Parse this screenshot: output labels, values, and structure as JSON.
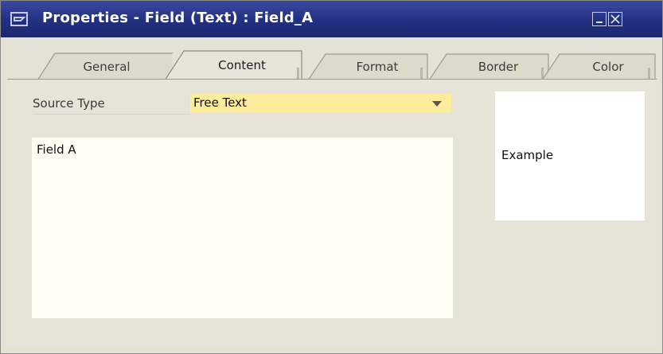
{
  "window": {
    "title": "Properties - Field (Text) : Field_A",
    "icon": "window-properties-icon"
  },
  "tabs": [
    {
      "label": "General",
      "active": false
    },
    {
      "label": "Content",
      "active": true
    },
    {
      "label": "Format",
      "active": false
    },
    {
      "label": "Border",
      "active": false
    },
    {
      "label": "Color",
      "active": false
    }
  ],
  "content": {
    "source_type_label": "Source Type",
    "source_type_value": "Free Text",
    "text_value": "Field A",
    "example_text": "Example"
  },
  "colors": {
    "title_bar": "#232f82",
    "dropdown_bg": "#fcec9c",
    "text_area_bg": "#fffef4",
    "panel_bg": "#e4e2d6"
  }
}
